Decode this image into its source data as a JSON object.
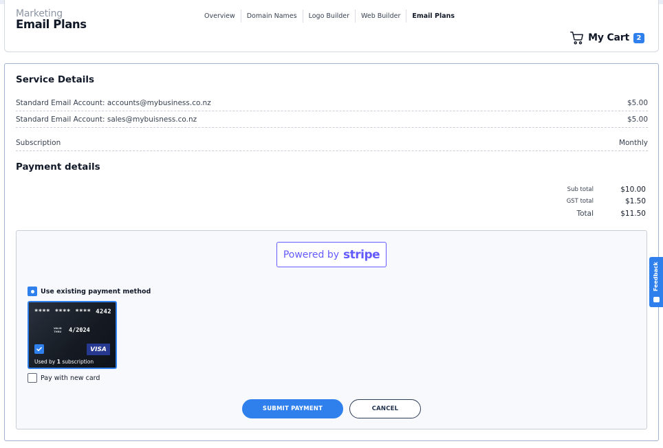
{
  "brand": {
    "line1": "Marketing",
    "line2": "Email Plans"
  },
  "nav": [
    {
      "label": "Overview",
      "active": false
    },
    {
      "label": "Domain Names",
      "active": false
    },
    {
      "label": "Logo Builder",
      "active": false
    },
    {
      "label": "Web Builder",
      "active": false
    },
    {
      "label": "Email Plans",
      "active": true
    }
  ],
  "cart": {
    "label": "My Cart",
    "count": "2",
    "icon": "shopping-cart-icon"
  },
  "service": {
    "title": "Service Details",
    "items": [
      {
        "label": "Standard Email Account: accounts@mybusiness.co.nz",
        "price": "$5.00"
      },
      {
        "label": "Standard Email Account: sales@mybuisness.co.nz",
        "price": "$5.00"
      }
    ],
    "subscription": {
      "label": "Subscription",
      "value": "Monthly"
    }
  },
  "payment": {
    "title": "Payment details",
    "subtotal": {
      "label": "Sub total",
      "value": "$10.00"
    },
    "gst": {
      "label": "GST total",
      "value": "$1.50"
    },
    "total": {
      "label": "Total",
      "value": "$11.50"
    }
  },
  "stripe": {
    "prefix": "Powered by",
    "brand": "stripe",
    "color": "#635bff"
  },
  "methods": {
    "existing_label": "Use existing payment method",
    "new_label": "Pay with new card"
  },
  "card": {
    "masked": [
      "****",
      "****",
      "****",
      "4242"
    ],
    "valid_thru_line1": "VALID",
    "valid_thru_line2": "THRU",
    "expiry": "4/2024",
    "brand": "VISA",
    "used_prefix": "Used by ",
    "used_count": "1",
    "used_suffix": " subscription"
  },
  "buttons": {
    "submit": "SUBMIT PAYMENT",
    "cancel": "CANCEL"
  },
  "feedback": {
    "label": "Feedback"
  },
  "colors": {
    "accent": "#2f80ed",
    "stripe": "#635bff",
    "card_bg": "#1b212b",
    "visa": "#26388f"
  }
}
